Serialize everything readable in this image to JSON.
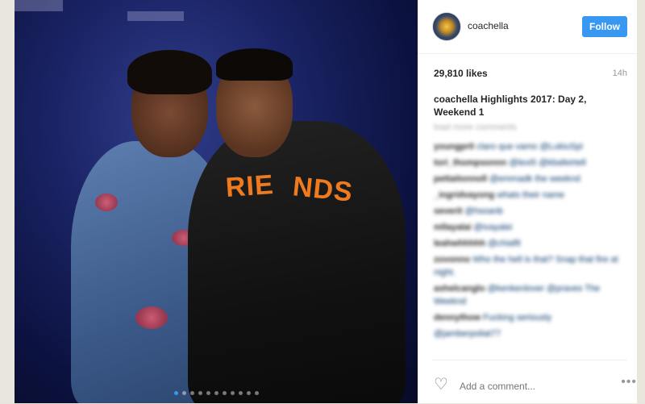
{
  "post": {
    "username": "coachella",
    "follow_label": "Follow",
    "likes": "29,810 likes",
    "time": "14h",
    "caption": "coachella Highlights 2017: Day 2, Weekend 1",
    "load_more": "load more comments",
    "comments": [
      {
        "user": "youngpr0",
        "text": "claro que vamo @LukiuSpi"
      },
      {
        "user": "tori_thompsonnn",
        "text": "@lexi5 @kbafeirtell"
      },
      {
        "user": "pettaitonnoll",
        "text": "@emmadk the weeknd"
      },
      {
        "user": "_ingridvayong",
        "text": "whats their name"
      },
      {
        "user": "severit",
        "text": "@hsoanb"
      },
      {
        "user": "mllayalai",
        "text": "@ivayalei"
      },
      {
        "user": "leahwhhhhh",
        "text": "@chiaf8"
      },
      {
        "user": "zovonno",
        "text": "Who the hell is that? Snap that fire at night."
      },
      {
        "user": "ashelcanglo",
        "text": "@kenkenlover @praves The Weeknd"
      },
      {
        "user": "dennythow",
        "text": "Fucking seriously"
      },
      {
        "user": "",
        "text": "@jamberpoliat77"
      }
    ],
    "add_comment_placeholder": "Add a comment...",
    "more_icon": "•••",
    "heart_icon": "♡"
  },
  "media": {
    "print_left": "RIE",
    "print_right": "NDS"
  },
  "carousel": {
    "count": 11,
    "active_index": 0
  },
  "colors": {
    "follow_button": "#3897f0",
    "text": "#262626",
    "muted": "#999999"
  }
}
